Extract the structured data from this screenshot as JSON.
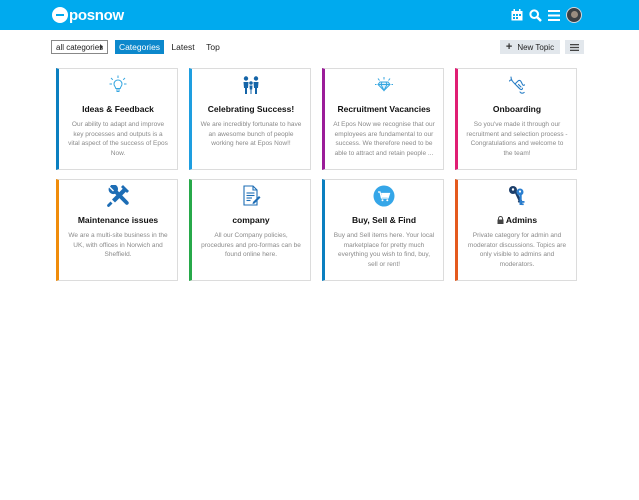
{
  "header": {
    "logo_text": "posnow",
    "icons": [
      "calendar-icon",
      "search-icon",
      "hamburger-icon",
      "avatar"
    ]
  },
  "toolbar": {
    "category_filter": "all categories",
    "tabs": [
      {
        "label": "Categories",
        "active": true
      },
      {
        "label": "Latest",
        "active": false
      },
      {
        "label": "Top",
        "active": false
      }
    ],
    "new_topic_label": "New Topic"
  },
  "categories": [
    {
      "title": "Ideas & Feedback",
      "description": "Our ability to adapt and improve key processes and outputs is a vital aspect of the success of Epos Now.",
      "color": "#0a7fc0",
      "icon": "lightbulb-icon"
    },
    {
      "title": "Celebrating Success!",
      "description": "We are incredibly fortunate to have an awesome bunch of people working here at Epos Now!!",
      "color": "#1e9ee0",
      "icon": "team-icon"
    },
    {
      "title": "Recruitment Vacancies",
      "description": "At Epos Now we recognise that our employees are fundamental to our success. We therefore need to be able to attract and retain people ...",
      "color": "#9b1c99",
      "icon": "diamond-icon"
    },
    {
      "title": "Onboarding",
      "description": "So you've made it through our recruitment and selection process - Congratulations and welcome to the team!",
      "color": "#e01e74",
      "icon": "handshake-icon"
    },
    {
      "title": "Maintenance issues",
      "description": "We are a multi-site business in the UK, with offices in Norwich and Sheffield.",
      "color": "#f08c0a",
      "icon": "tools-icon"
    },
    {
      "title": "company",
      "description": "All our Company policies, procedures and pro-formas can be found online here.",
      "color": "#27a94a",
      "icon": "document-icon"
    },
    {
      "title": "Buy, Sell & Find",
      "description": "Buy and Sell items here. Your local marketplace for pretty much everything you wish to find, buy, sell or rent!",
      "color": "#0a7fc0",
      "icon": "cart-icon"
    },
    {
      "title": "Admins",
      "description": "Private category for admin and moderator discussions. Topics are only visible to admins and moderators.",
      "color": "#e45a1e",
      "icon": "keys-icon",
      "locked": true
    }
  ]
}
